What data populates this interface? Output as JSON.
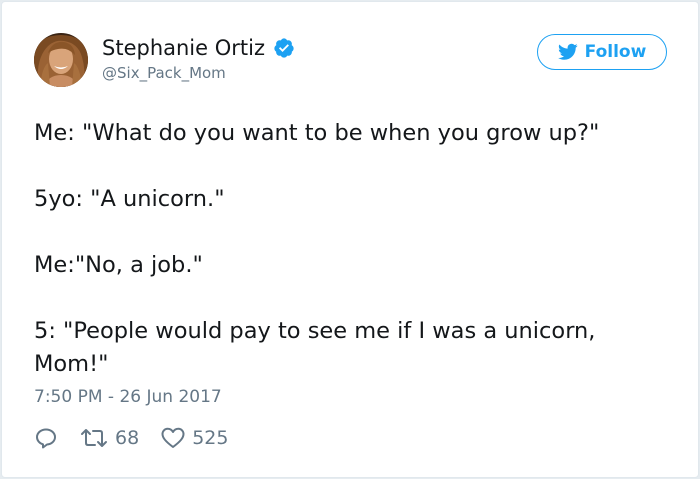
{
  "user": {
    "name": "Stephanie Ortiz",
    "handle": "@Six_Pack_Mom",
    "verified": true,
    "avatar_icon": "profile-photo"
  },
  "follow_button": {
    "label": "Follow",
    "icon": "twitter-bird-icon"
  },
  "tweet": {
    "lines": [
      "Me: \"What do you want to be when you grow up?\"",
      "5yo: \"A unicorn.\"",
      "Me:\"No, a job.\"",
      "5: \"People would pay to see me if I was a unicorn,",
      "Mom!\""
    ]
  },
  "timestamp": "7:50 PM - 26 Jun 2017",
  "actions": {
    "reply_icon": "reply-icon",
    "retweet_count": "68",
    "like_count": "525"
  },
  "colors": {
    "accent": "#1da1f2",
    "text": "#14171a",
    "secondary": "#657786"
  }
}
